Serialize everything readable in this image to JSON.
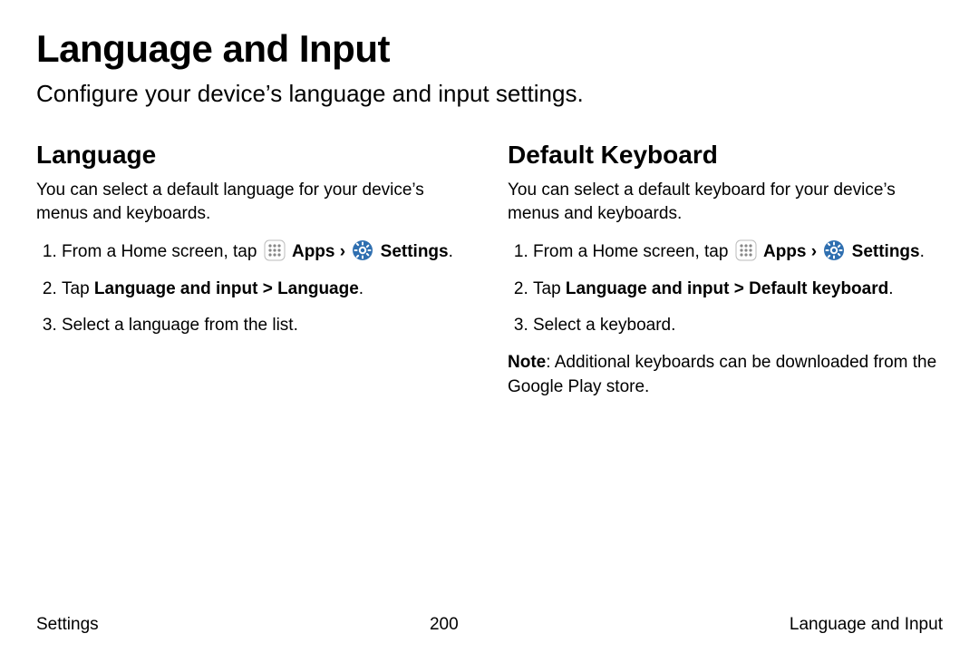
{
  "page": {
    "title": "Language and Input",
    "subtitle": "Configure your device’s language and input settings."
  },
  "left": {
    "heading": "Language",
    "intro": "You can select a default language for your device’s menus and keyboards.",
    "step1_prefix": "From a Home screen, tap ",
    "apps_label": "Apps",
    "gt": " › ",
    "settings_label": "Settings",
    "period": ".",
    "step2_prefix": "Tap ",
    "step2_bold": "Language and input > Language",
    "step3": "Select a language from the list."
  },
  "right": {
    "heading": "Default Keyboard",
    "intro": "You can select a default keyboard for your device’s menus and keyboards.",
    "step1_prefix": "From a Home screen, tap ",
    "apps_label": "Apps",
    "gt": " › ",
    "settings_label": "Settings",
    "period": ".",
    "step2_prefix": "Tap ",
    "step2_bold": "Language and input > Default keyboard",
    "step3": "Select a keyboard.",
    "note_label": "Note",
    "note_text": ": Additional keyboards can be downloaded from the Google Play store."
  },
  "footer": {
    "left": "Settings",
    "center": "200",
    "right": "Language and Input"
  },
  "icons": {
    "apps": "apps-grid-icon",
    "settings": "settings-gear-icon"
  }
}
